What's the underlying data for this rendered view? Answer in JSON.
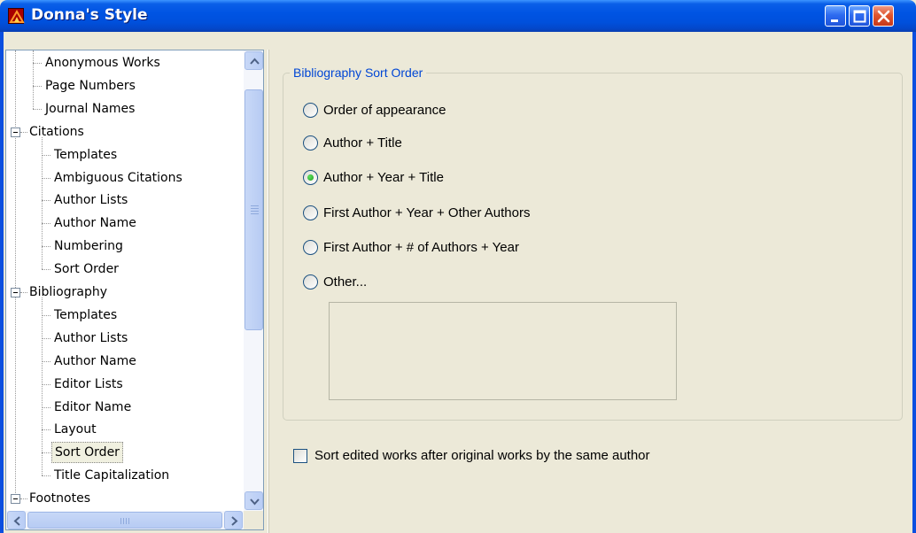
{
  "window": {
    "title": "Donna's Style",
    "buttons": [
      "minimize",
      "maximize",
      "close"
    ]
  },
  "tree": {
    "items": [
      {
        "label": "Anonymous Works",
        "level": 1,
        "last": false
      },
      {
        "label": "Page Numbers",
        "level": 1,
        "last": false
      },
      {
        "label": "Journal Names",
        "level": 1,
        "last": false
      },
      {
        "label": "Citations",
        "level": 0,
        "expanded": true
      },
      {
        "label": "Templates",
        "level": 1,
        "last": false
      },
      {
        "label": "Ambiguous Citations",
        "level": 1,
        "last": false
      },
      {
        "label": "Author Lists",
        "level": 1,
        "last": false
      },
      {
        "label": "Author Name",
        "level": 1,
        "last": false
      },
      {
        "label": "Numbering",
        "level": 1,
        "last": false
      },
      {
        "label": "Sort Order",
        "level": 1,
        "last": true
      },
      {
        "label": "Bibliography",
        "level": 0,
        "expanded": true
      },
      {
        "label": "Templates",
        "level": 1,
        "last": false
      },
      {
        "label": "Author Lists",
        "level": 1,
        "last": false
      },
      {
        "label": "Author Name",
        "level": 1,
        "last": false
      },
      {
        "label": "Editor Lists",
        "level": 1,
        "last": false
      },
      {
        "label": "Editor Name",
        "level": 1,
        "last": false
      },
      {
        "label": "Layout",
        "level": 1,
        "last": false
      },
      {
        "label": "Sort Order",
        "level": 1,
        "last": false,
        "selected": true
      },
      {
        "label": "Title Capitalization",
        "level": 1,
        "last": true
      },
      {
        "label": "Footnotes",
        "level": 0,
        "expanded": true
      }
    ]
  },
  "group": {
    "title": "Bibliography Sort Order",
    "options": [
      {
        "label": "Order of appearance",
        "checked": false
      },
      {
        "label": "Author + Title",
        "checked": false
      },
      {
        "label": "Author + Year + Title",
        "checked": true
      },
      {
        "label": "First Author + Year + Other Authors",
        "checked": false
      },
      {
        "label": "First Author + # of Authors + Year",
        "checked": false
      },
      {
        "label": "Other...",
        "checked": false
      }
    ],
    "other_text": ""
  },
  "checkbox": {
    "label": "Sort edited works after original works by the same author",
    "checked": false
  },
  "colors": {
    "titlebar": "#0054e3",
    "group_title": "#0046d5",
    "radio_checked": "#21a121",
    "window_bg": "#ece9d8"
  }
}
